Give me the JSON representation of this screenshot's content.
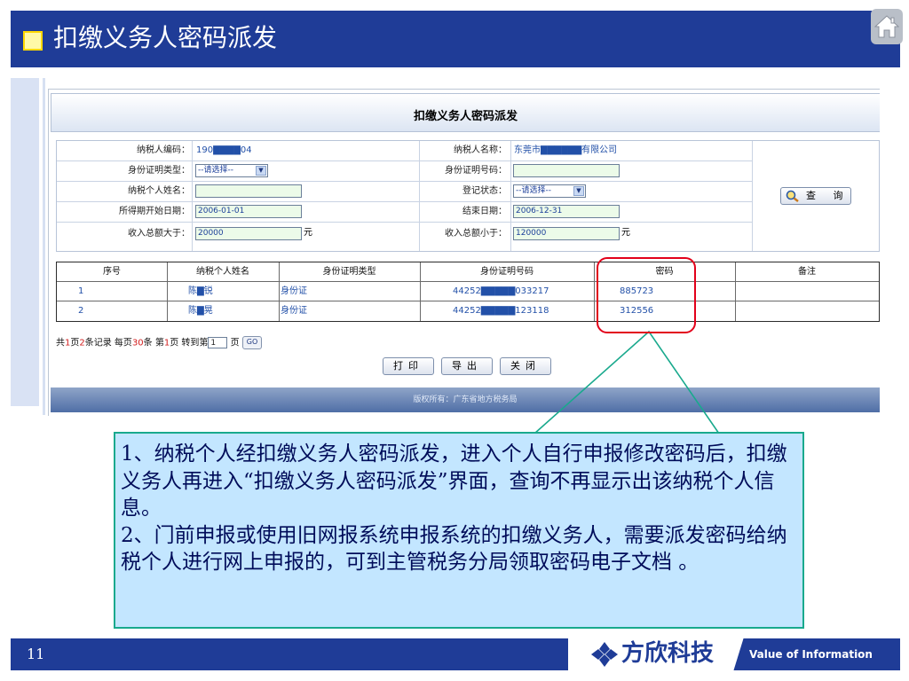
{
  "slide": {
    "title": "扣缴义务人密码派发",
    "page_number": "11",
    "brand_name": "方欣科技",
    "tagline": "Value of Information"
  },
  "web_page": {
    "title": "扣缴义务人密码派发",
    "form": {
      "taxpayer_code_label": "纳税人编码：",
      "taxpayer_code_value": "190▇▇▇▇04",
      "taxpayer_name_label": "纳税人名称：",
      "taxpayer_name_value": "东莞市▇▇▇▇▇▇有限公司",
      "id_type_label": "身份证明类型：",
      "id_type_value": "--请选择--",
      "id_number_label": "身份证明号码：",
      "id_number_value": "",
      "person_name_label": "纳税个人姓名：",
      "person_name_value": "",
      "reg_status_label": "登记状态：",
      "reg_status_value": "--请选择--",
      "start_date_label": "所得期开始日期：",
      "start_date_value": "2006-01-01",
      "end_date_label": "结束日期：",
      "end_date_value": "2006-12-31",
      "income_gt_label": "收入总额大于：",
      "income_gt_value": "20000",
      "income_lt_label": "收入总额小于：",
      "income_lt_value": "120000",
      "unit": "元",
      "query_button": "查 询"
    },
    "table": {
      "headers": [
        "序号",
        "纳税个人姓名",
        "身份证明类型",
        "身份证明号码",
        "密码",
        "备注"
      ],
      "rows": [
        [
          "1",
          "陈▇锐",
          "身份证",
          "44252▇▇▇▇▇033217",
          "885723",
          ""
        ],
        [
          "2",
          "陈▇晃",
          "身份证",
          "44252▇▇▇▇▇123118",
          "312556",
          ""
        ]
      ]
    },
    "pager": {
      "p1": "共",
      "total_pages": "1",
      "p2": "页",
      "total_records": "2",
      "p3": "条记录  每页",
      "per_page": "30",
      "p4": "条  第",
      "current_page": "1",
      "p5": "页  转到第",
      "goto_value": "1",
      "p6": " 页",
      "go_label": "GO"
    },
    "buttons": {
      "print": "打印",
      "export": "导出",
      "close": "关闭"
    },
    "footer": "版权所有：广东省地方税务局"
  },
  "callout": {
    "line1": "1、纳税个人经扣缴义务人密码派发，进入个人自行申报修改密码后，扣缴义务人再进入“扣缴义务人密码派发”界面，查询不再显示出该纳税个人信息。",
    "line2": "2、门前申报或使用旧网报系统申报系统的扣缴义务人，需要派发密码给纳税个人进行网上申报的，可到主管税务分局领取密码电子文档 。"
  },
  "colors": {
    "header_blue": "#1f3c97",
    "highlight_red": "#e2001a",
    "callout_fill": "#c3e6ff",
    "callout_border": "#19a98d"
  }
}
